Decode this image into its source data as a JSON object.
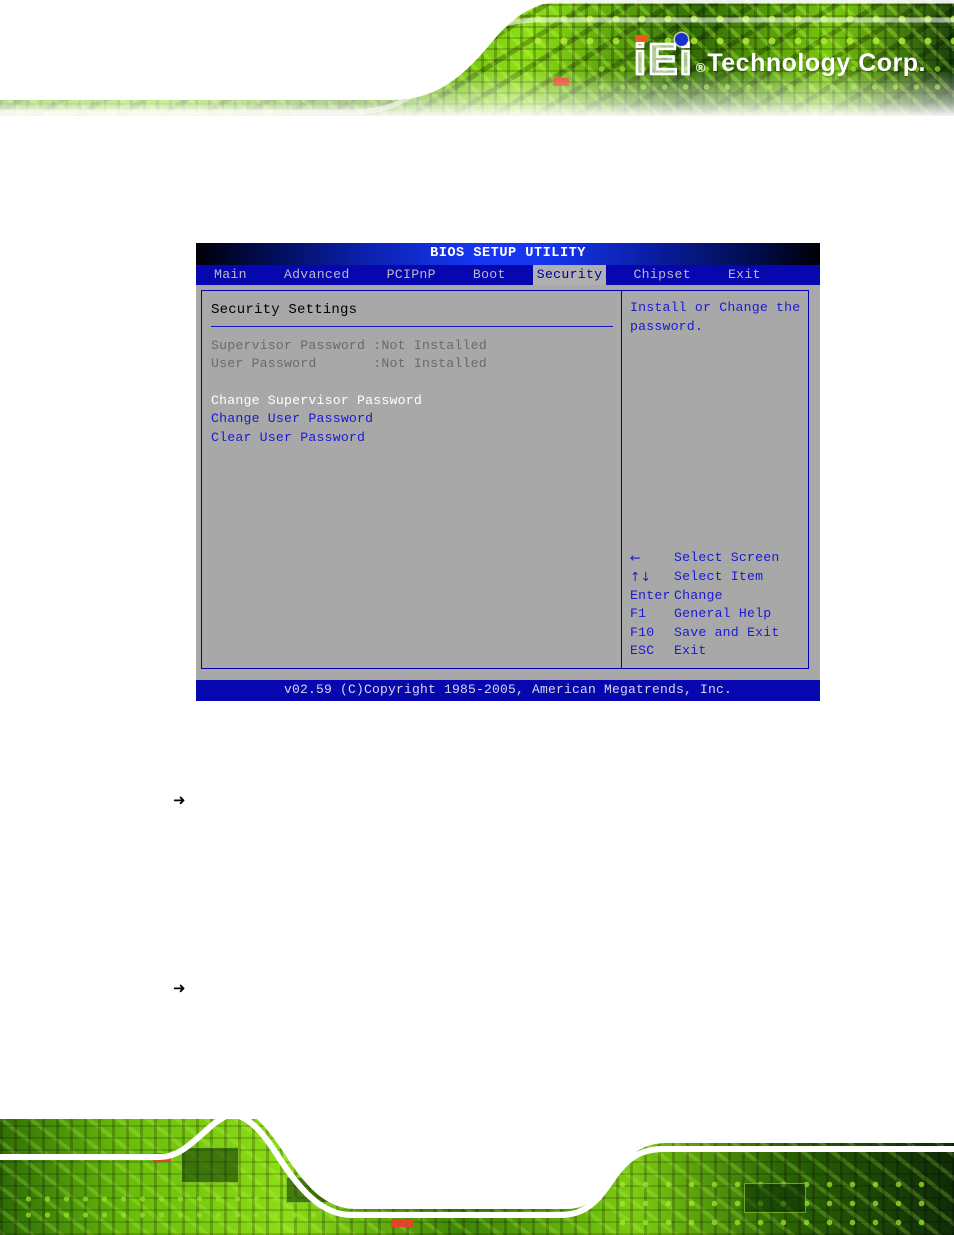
{
  "page": {
    "header": {
      "logo_letters": [
        "i",
        "E",
        "i"
      ],
      "logo_registered": "®",
      "logo_company": "Technology Corp."
    },
    "bullets": [
      {
        "glyph": "➜"
      },
      {
        "glyph": "➜"
      }
    ]
  },
  "bios": {
    "title": "BIOS SETUP UTILITY",
    "tabs": [
      {
        "label": "Main",
        "selected": false
      },
      {
        "label": "Advanced",
        "selected": false
      },
      {
        "label": "PCIPnP",
        "selected": false
      },
      {
        "label": "Boot",
        "selected": false
      },
      {
        "label": "Security",
        "selected": true
      },
      {
        "label": "Chipset",
        "selected": false
      },
      {
        "label": "Exit",
        "selected": false
      }
    ],
    "section_title": "Security Settings",
    "status_rows": [
      {
        "label": "Supervisor Password",
        "value": ":Not Installed"
      },
      {
        "label": "User Password",
        "value": ":Not Installed"
      }
    ],
    "status_lines": [
      "Supervisor Password :Not Installed",
      "User Password       :Not Installed"
    ],
    "actions": [
      {
        "label": "Change Supervisor Password",
        "state": "selected"
      },
      {
        "label": "Change User Password",
        "state": "normal"
      },
      {
        "label": "Clear User Password",
        "state": "normal"
      }
    ],
    "help": {
      "lines": [
        "Install or Change the",
        "password."
      ]
    },
    "nav_keys": [
      {
        "key": "←",
        "action": "Select Screen"
      },
      {
        "key": "↑↓",
        "action": "Select Item"
      },
      {
        "key": "Enter",
        "action": "Change"
      },
      {
        "key": "F1",
        "action": "General Help"
      },
      {
        "key": "F10",
        "action": "Save and Exit"
      },
      {
        "key": "ESC",
        "action": "Exit"
      }
    ],
    "footer": "v02.59 (C)Copyright 1985-2005, American Megatrends, Inc."
  },
  "colors": {
    "bios_blue": "#0707b0",
    "bios_gray": "#a8a8a8",
    "text_blue": "#1a1ad2",
    "text_dim": "#6a6a6a",
    "text_white": "#ffffff",
    "tab_selected_bg": "#b0b0b0",
    "pcb_green": "#86d813"
  }
}
